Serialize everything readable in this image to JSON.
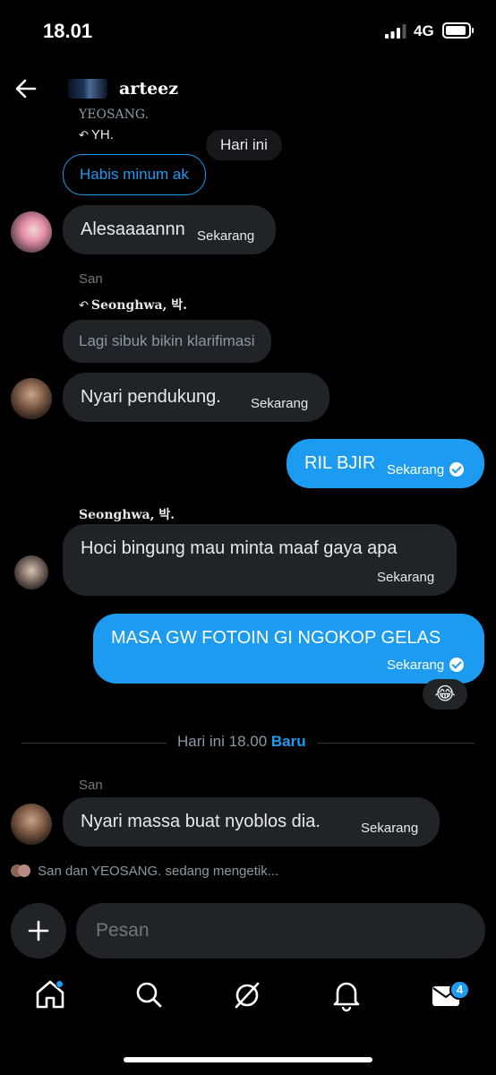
{
  "status_bar": {
    "time": "18.01",
    "network": "4G",
    "battery_level": 0.85,
    "signal_bars": 3
  },
  "header": {
    "title": "arteez",
    "back_icon": "arrow-left-icon",
    "avatar_icon": "group-avatar"
  },
  "messages": {
    "yh_context": {
      "sender": "YEOSANG.",
      "reply_to": "YH.",
      "quoted_text": "Habis minum ak"
    },
    "date_pill": "Hari ini",
    "m1": {
      "text": "Alesaaaannn",
      "time": "Sekarang"
    },
    "san_reply": {
      "sender": "San",
      "reply_to": "Seonghwa, 박.",
      "quoted_text": "Lagi sibuk bikin klarifimasi"
    },
    "m2": {
      "text": "Nyari pendukung.",
      "time": "Sekarang"
    },
    "m3_out": {
      "text": "RIL BJIR",
      "time": "Sekarang"
    },
    "m4": {
      "sender": "Seonghwa, 박.",
      "text": "Hoci bingung mau minta maaf gaya apa",
      "time": "Sekarang"
    },
    "m5_out": {
      "text": "MASA GW FOTOIN GI NGOKOP GELAS",
      "time": "Sekarang",
      "reaction": "😂"
    },
    "divider": {
      "label": "Hari ini 18.00",
      "new_label": "Baru"
    },
    "m6": {
      "sender": "San",
      "text": "Nyari massa buat nyoblos dia.",
      "time": "Sekarang"
    }
  },
  "typing_indicator": "San dan YEOSANG. sedang mengetik...",
  "composer": {
    "placeholder": "Pesan",
    "add_icon": "plus-icon"
  },
  "tabbar": {
    "items": [
      "home-icon",
      "search-icon",
      "grok-icon",
      "bell-icon",
      "mail-icon"
    ],
    "messages_badge": "4"
  },
  "colors": {
    "accent": "#1d9bf0",
    "bubble_in": "#202327",
    "background": "#000000"
  }
}
